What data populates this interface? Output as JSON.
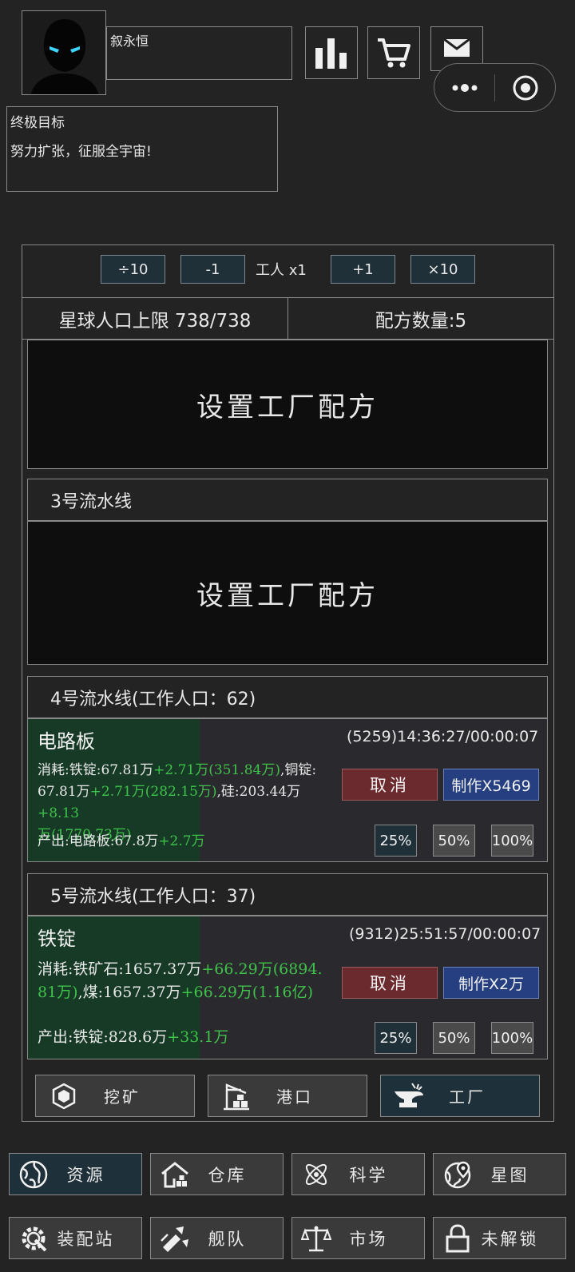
{
  "header": {
    "player_name": "叙永恒",
    "icons": [
      "bar-chart-icon",
      "cart-icon",
      "mail-icon"
    ],
    "capsule_icons": [
      "more-dots-icon",
      "target-circle-icon"
    ]
  },
  "goal": {
    "title": "终极目标",
    "text": "努力扩张，征服全宇宙!"
  },
  "controls": {
    "div10": "÷10",
    "minus1": "-1",
    "worker": "工人 x1",
    "plus1": "+1",
    "times10": "×10"
  },
  "info": {
    "population": "星球人口上限 738/738",
    "recipes": "配方数量:5"
  },
  "slots": {
    "set_recipe_1": "设置工厂配方",
    "line3_title": "3号流水线",
    "set_recipe_2": "设置工厂配方"
  },
  "line4": {
    "title": "4号流水线(工作人口：62)",
    "product": "电路板",
    "timer": "(5259)14:36:27/00:00:07",
    "progress": 0.33,
    "consume_l1a": "消耗:铁锭:67.81万",
    "consume_l1b": "+2.71万(351.84万)",
    "consume_l1c": ",铜锭:",
    "consume_l2a": "67.81万",
    "consume_l2b": "+2.71万(282.15万)",
    "consume_l2c": ",硅:203.44万",
    "consume_l2d": "+8.13",
    "consume_l3": "万(1770.73万)",
    "output_a": "产出:电路板:67.8万",
    "output_b": "+2.7万",
    "cancel": "取消",
    "make": "制作X5469",
    "pct": [
      "25%",
      "50%",
      "100%"
    ]
  },
  "line5": {
    "title": "5号流水线(工作人口：37)",
    "product": "铁锭",
    "timer": "(9312)25:51:57/00:00:07",
    "progress": 0.33,
    "consume_l1a": "消耗:铁矿石:1657.37万",
    "consume_l1b": "+66.29万(6894.",
    "consume_l2a": "81万)",
    "consume_l2b": ",煤:1657.37万",
    "consume_l2c": "+66.29万(1.16亿)",
    "output_a": "产出:铁锭:828.6万",
    "output_b": "+33.1万",
    "cancel": "取消",
    "make": "制作X2万",
    "pct": [
      "25%",
      "50%",
      "100%"
    ]
  },
  "sub_tabs": [
    {
      "label": "挖矿",
      "icon": "gem-icon"
    },
    {
      "label": "港口",
      "icon": "crane-icon"
    },
    {
      "label": "工厂",
      "icon": "anvil-icon",
      "active": true
    }
  ],
  "nav": [
    {
      "label": "资源",
      "icon": "planet-icon",
      "active": true
    },
    {
      "label": "仓库",
      "icon": "warehouse-icon"
    },
    {
      "label": "科学",
      "icon": "atom-icon"
    },
    {
      "label": "星图",
      "icon": "star-map-icon"
    },
    {
      "label": "装配站",
      "icon": "gear-wrench-icon"
    },
    {
      "label": "舰队",
      "icon": "fleet-icon"
    },
    {
      "label": "市场",
      "icon": "scales-icon"
    },
    {
      "label": "未解锁",
      "icon": "lock-icon"
    }
  ],
  "colors": {
    "background": "#232323",
    "active_button": "#203039",
    "cancel_button": "#6b2a2e",
    "make_button": "#253f80",
    "progress_fill": "#163a26",
    "gain_text": "#3fc24a"
  }
}
